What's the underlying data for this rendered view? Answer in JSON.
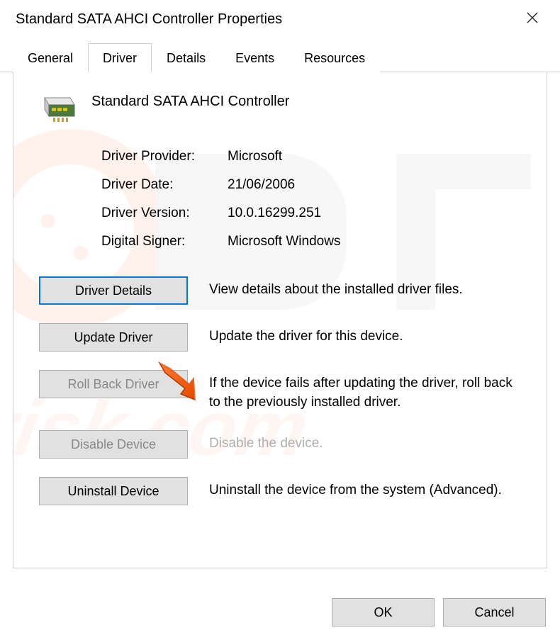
{
  "window": {
    "title": "Standard SATA AHCI Controller Properties"
  },
  "tabs": {
    "general": "General",
    "driver": "Driver",
    "details": "Details",
    "events": "Events",
    "resources": "Resources",
    "active": "Driver"
  },
  "device": {
    "name": "Standard SATA AHCI Controller"
  },
  "info": {
    "provider_label": "Driver Provider:",
    "provider_value": "Microsoft",
    "date_label": "Driver Date:",
    "date_value": "21/06/2006",
    "version_label": "Driver Version:",
    "version_value": "10.0.16299.251",
    "signer_label": "Digital Signer:",
    "signer_value": "Microsoft Windows"
  },
  "actions": {
    "details_label": "Driver Details",
    "details_desc": "View details about the installed driver files.",
    "update_label": "Update Driver",
    "update_desc": "Update the driver for this device.",
    "rollback_label": "Roll Back Driver",
    "rollback_desc": "If the device fails after updating the driver, roll back to the previously installed driver.",
    "disable_label": "Disable Device",
    "disable_desc": "Disable the device.",
    "uninstall_label": "Uninstall Device",
    "uninstall_desc": "Uninstall the device from the system (Advanced)."
  },
  "footer": {
    "ok": "OK",
    "cancel": "Cancel"
  }
}
